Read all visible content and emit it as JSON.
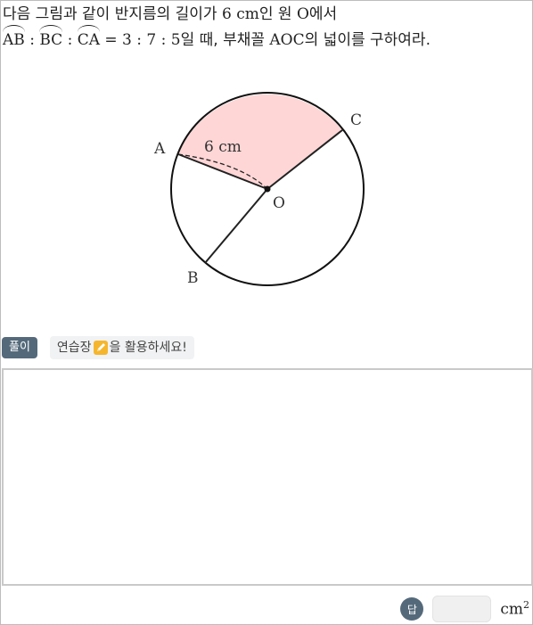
{
  "problem": {
    "line1_text": "다음 그림과 같이 반지름의 길이가 ",
    "radius_value": "6 cm",
    "line1_mid": "인 원 ",
    "center": "O",
    "line1_end": "에서",
    "arc1": "AB",
    "arc2": "BC",
    "arc3": "CA",
    "colon": ":",
    "ratio": "= 3 : 7 : 5",
    "line2_end": "일 때, 부채꼴 ",
    "sector_name": "AOC",
    "line2_tail": "의 넓이를 구하여라."
  },
  "figure": {
    "label_a": "A",
    "label_b": "B",
    "label_c": "C",
    "label_o": "O",
    "radius_label": "6 cm",
    "sector_color": "#ffd6d6"
  },
  "solution": {
    "badge": "풀이",
    "hint_before": "연습장",
    "hint_after": "을 활용하세요!"
  },
  "answer": {
    "badge": "답",
    "value": "",
    "unit": "cm",
    "unit_power": "2"
  },
  "colors": {
    "badge_bg": "#546a7b",
    "pencil_icon": "#f5b62e"
  }
}
